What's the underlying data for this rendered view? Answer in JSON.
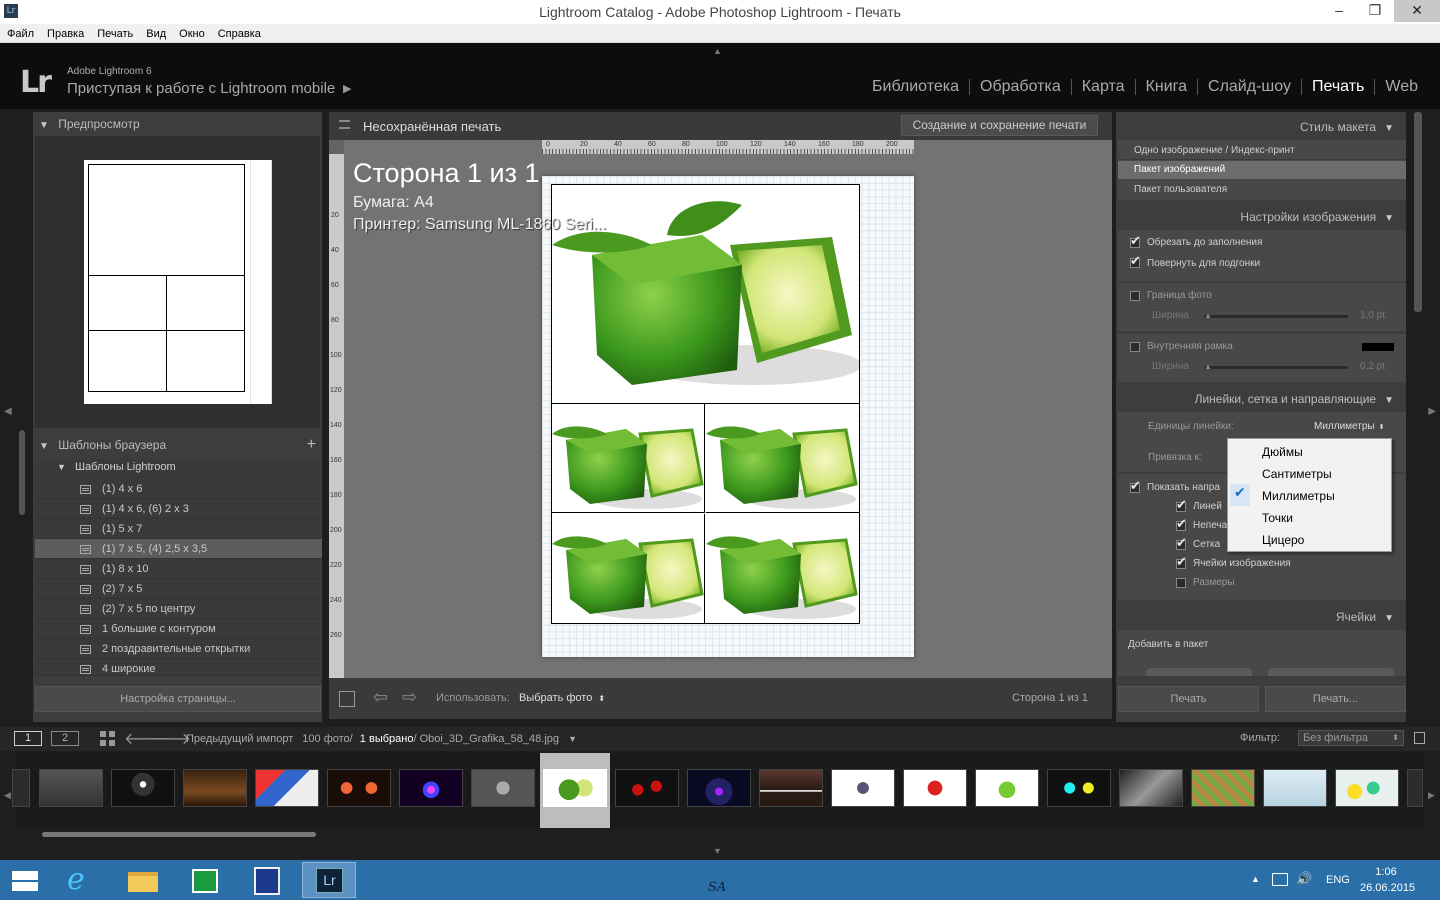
{
  "window": {
    "title": "Lightroom Catalog - Adobe Photoshop Lightroom - Печать",
    "app_icon": "Lr",
    "min": "–",
    "max": "❐",
    "close": "✕"
  },
  "menu": [
    "Файл",
    "Правка",
    "Печать",
    "Вид",
    "Окно",
    "Справка"
  ],
  "identity": {
    "logo": "Lr",
    "product": "Adobe Lightroom 6",
    "task": "Приступая к работе с Lightroom mobile",
    "arrow": "▶"
  },
  "modules": [
    {
      "label": "Библиотека",
      "active": false
    },
    {
      "label": "Обработка",
      "active": false
    },
    {
      "label": "Карта",
      "active": false
    },
    {
      "label": "Книга",
      "active": false
    },
    {
      "label": "Слайд-шоу",
      "active": false
    },
    {
      "label": "Печать",
      "active": true
    },
    {
      "label": "Web",
      "active": false
    }
  ],
  "left": {
    "preview_title": "Предпросмотр",
    "browser_title": "Шаблоны браузера",
    "browser_add": "+",
    "folder": "Шаблоны Lightroom",
    "templates": [
      {
        "label": "(1) 4 x 6",
        "selected": false
      },
      {
        "label": "(1) 4 x 6, (6) 2 x 3",
        "selected": false
      },
      {
        "label": "(1) 5 x 7",
        "selected": false
      },
      {
        "label": "(1) 7 x 5, (4) 2,5 x 3,5",
        "selected": true
      },
      {
        "label": "(1) 8 x 10",
        "selected": false
      },
      {
        "label": "(2) 7 x 5",
        "selected": false
      },
      {
        "label": "(2) 7 x 5 по центру",
        "selected": false
      },
      {
        "label": "1 большие с контуром",
        "selected": false
      },
      {
        "label": "2 поздравительные открытки",
        "selected": false
      },
      {
        "label": "4 широкие",
        "selected": false
      }
    ],
    "page_setup": "Настройка страницы..."
  },
  "center": {
    "doc_title": "Несохранённая печать",
    "save_button": "Создание и сохранение печати",
    "page_heading": "Сторона 1 из 1",
    "paper": "Бумага:  A4",
    "printer": "Принтер:  Samsung ML-1860 Seri...",
    "ruler_labels": [
      "0",
      "20",
      "40",
      "60",
      "80",
      "100",
      "120",
      "140",
      "160",
      "180",
      "200"
    ],
    "vruler_labels": [
      "20",
      "40",
      "60",
      "80",
      "100",
      "120",
      "140",
      "160",
      "180",
      "200",
      "220",
      "240",
      "260"
    ],
    "use_label": "Использовать:",
    "use_value": "Выбрать фото",
    "page_count": "Сторона 1 из 1"
  },
  "right": {
    "layout_style_title": "Стиль макета",
    "layout_options": [
      {
        "label": "Одно изображение / Индекс-принт",
        "selected": false
      },
      {
        "label": "Пакет изображений",
        "selected": true
      },
      {
        "label": "Пакет пользователя",
        "selected": false
      }
    ],
    "image_settings_title": "Настройки изображения",
    "crop_fill": "Обрезать до заполнения",
    "rotate_fit": "Повернуть для подгонки",
    "photo_border": "Граница фото",
    "width": "Ширина",
    "border_width": "1,0 pt",
    "inner_stroke": "Внутренняя рамка",
    "inner_width": "0,2 pt",
    "rulers_title": "Линейки, сетка и направляющие",
    "ruler_units_label": "Единицы линейки:",
    "ruler_units_value": "Миллиметры",
    "snap_label": "Привязка к:",
    "show_guides": "Показать напра",
    "guide_rulers": "Линей",
    "guide_bleed": "Непеча",
    "guide_grid": "Сетка",
    "guide_cells": "Ячейки изображения",
    "guide_dims": "Размеры",
    "cells_title": "Ячейки",
    "add_to_package": "Добавить в пакет",
    "print_btn": "Печать",
    "print_dlg_btn": "Печать..."
  },
  "dropdown": {
    "options": [
      {
        "label": "Дюймы",
        "checked": false
      },
      {
        "label": "Сантиметры",
        "checked": false
      },
      {
        "label": "Миллиметры",
        "checked": true
      },
      {
        "label": "Точки",
        "checked": false
      },
      {
        "label": "Цицеро",
        "checked": false
      }
    ]
  },
  "filmbar": {
    "view1": "1",
    "view2": "2",
    "source": "Предыдущий импорт",
    "count": "100 фото/",
    "selected": "1 выбрано",
    "file": "/ Oboi_3D_Grafika_58_48.jpg",
    "filter_label": "Фильтр:",
    "filter_value": "Без фильтра"
  },
  "taskbar": {
    "lang": "ENG",
    "time": "1:06",
    "date": "26.06.2015",
    "center_text": "SA"
  }
}
